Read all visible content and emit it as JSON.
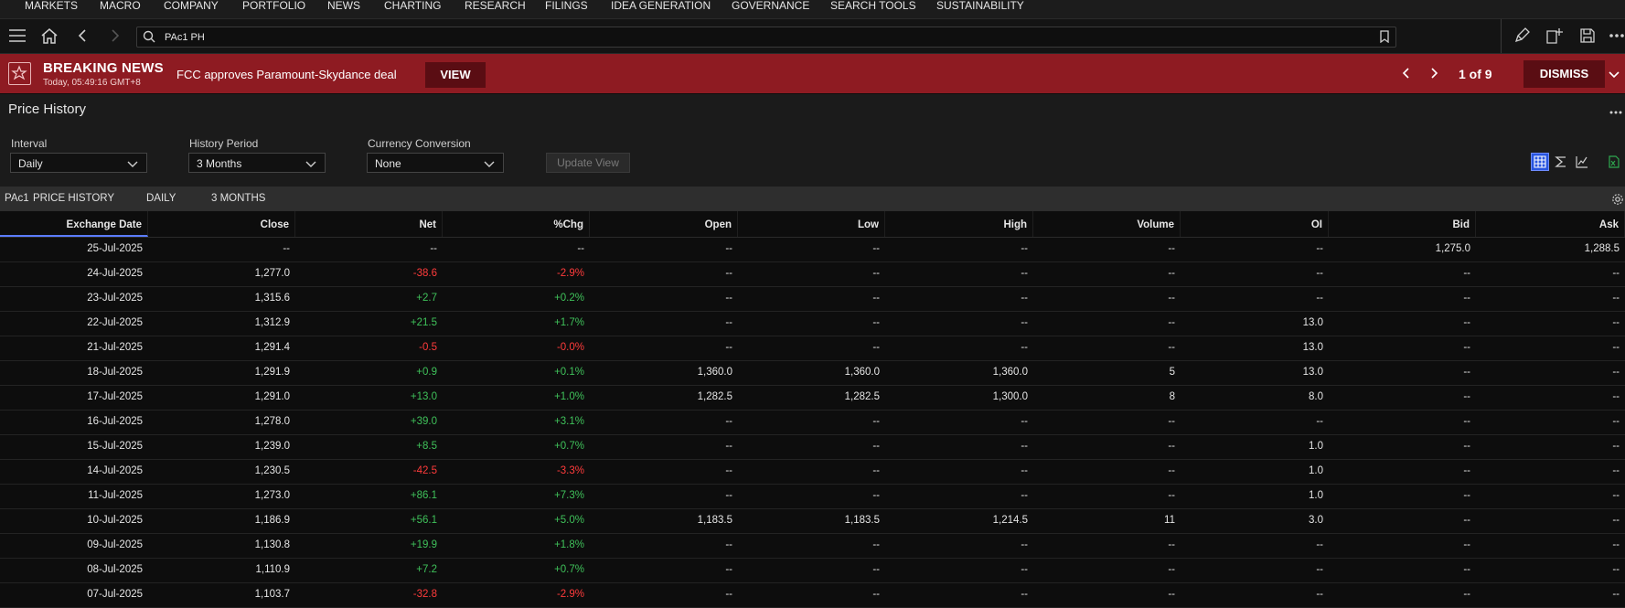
{
  "top_nav": [
    "MARKETS",
    "MACRO",
    "COMPANY",
    "PORTFOLIO",
    "NEWS",
    "CHARTING",
    "RESEARCH",
    "FILINGS",
    "IDEA GENERATION",
    "GOVERNANCE",
    "SEARCH TOOLS",
    "SUSTAINABILITY"
  ],
  "toolbar": {
    "search_value": "PAc1 PH",
    "icons": [
      "menu-icon",
      "home-icon",
      "back-icon",
      "forward-icon",
      "search-icon",
      "bookmark-icon",
      "edit-icon",
      "new-window-icon",
      "save-icon",
      "more-icon"
    ]
  },
  "breaking_news": {
    "title": "BREAKING NEWS",
    "time": "Today, 05:49:16 GMT+8",
    "headline": "FCC approves Paramount-Skydance deal",
    "view_label": "VIEW",
    "counter": "1 of 9",
    "dismiss_label": "DISMISS",
    "bg_color": "#8e1b22"
  },
  "panel": {
    "title": "Price History"
  },
  "controls": {
    "interval_label": "Interval",
    "interval_value": "Daily",
    "period_label": "History Period",
    "period_value": "3 Months",
    "currency_label": "Currency Conversion",
    "currency_value": "None",
    "update_label": "Update View"
  },
  "subheader": {
    "ric": "PAc1",
    "title": "PRICE HISTORY",
    "interval": "DAILY",
    "period": "3 MONTHS"
  },
  "table": {
    "columns": [
      "Exchange Date",
      "Close",
      "Net",
      "%Chg",
      "Open",
      "Low",
      "High",
      "Volume",
      "OI",
      "Bid",
      "Ask"
    ],
    "rows": [
      [
        "25-Jul-2025",
        "--",
        "--",
        "--",
        "--",
        "--",
        "--",
        "--",
        "--",
        "1,275.0",
        "1,288.5"
      ],
      [
        "24-Jul-2025",
        "1,277.0",
        "-38.6",
        "-2.9%",
        "--",
        "--",
        "--",
        "--",
        "--",
        "--",
        "--"
      ],
      [
        "23-Jul-2025",
        "1,315.6",
        "+2.7",
        "+0.2%",
        "--",
        "--",
        "--",
        "--",
        "--",
        "--",
        "--"
      ],
      [
        "22-Jul-2025",
        "1,312.9",
        "+21.5",
        "+1.7%",
        "--",
        "--",
        "--",
        "--",
        "13.0",
        "--",
        "--"
      ],
      [
        "21-Jul-2025",
        "1,291.4",
        "-0.5",
        "-0.0%",
        "--",
        "--",
        "--",
        "--",
        "13.0",
        "--",
        "--"
      ],
      [
        "18-Jul-2025",
        "1,291.9",
        "+0.9",
        "+0.1%",
        "1,360.0",
        "1,360.0",
        "1,360.0",
        "5",
        "13.0",
        "--",
        "--"
      ],
      [
        "17-Jul-2025",
        "1,291.0",
        "+13.0",
        "+1.0%",
        "1,282.5",
        "1,282.5",
        "1,300.0",
        "8",
        "8.0",
        "--",
        "--"
      ],
      [
        "16-Jul-2025",
        "1,278.0",
        "+39.0",
        "+3.1%",
        "--",
        "--",
        "--",
        "--",
        "--",
        "--",
        "--"
      ],
      [
        "15-Jul-2025",
        "1,239.0",
        "+8.5",
        "+0.7%",
        "--",
        "--",
        "--",
        "--",
        "1.0",
        "--",
        "--"
      ],
      [
        "14-Jul-2025",
        "1,230.5",
        "-42.5",
        "-3.3%",
        "--",
        "--",
        "--",
        "--",
        "1.0",
        "--",
        "--"
      ],
      [
        "11-Jul-2025",
        "1,273.0",
        "+86.1",
        "+7.3%",
        "--",
        "--",
        "--",
        "--",
        "1.0",
        "--",
        "--"
      ],
      [
        "10-Jul-2025",
        "1,186.9",
        "+56.1",
        "+5.0%",
        "1,183.5",
        "1,183.5",
        "1,214.5",
        "11",
        "3.0",
        "--",
        "--"
      ],
      [
        "09-Jul-2025",
        "1,130.8",
        "+19.9",
        "+1.8%",
        "--",
        "--",
        "--",
        "--",
        "--",
        "--",
        "--"
      ],
      [
        "08-Jul-2025",
        "1,110.9",
        "+7.2",
        "+0.7%",
        "--",
        "--",
        "--",
        "--",
        "--",
        "--",
        "--"
      ],
      [
        "07-Jul-2025",
        "1,103.7",
        "-32.8",
        "-2.9%",
        "--",
        "--",
        "--",
        "--",
        "--",
        "--",
        "--"
      ]
    ]
  },
  "colors": {
    "positive": "#3fc15a",
    "negative": "#ff3b3b",
    "accent": "#2855e0"
  }
}
